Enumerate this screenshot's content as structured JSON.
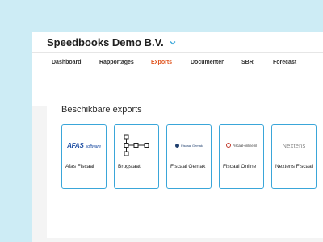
{
  "header": {
    "org_name": "Speedbooks Demo B.V."
  },
  "tabs": [
    {
      "label": "Dashboard",
      "active": false
    },
    {
      "label": "Rapportages",
      "active": false
    },
    {
      "label": "Exports",
      "active": true
    },
    {
      "label": "Documenten",
      "active": false
    },
    {
      "label": "SBR",
      "active": false
    },
    {
      "label": "Forecast",
      "active": false
    }
  ],
  "exports": {
    "title": "Beschikbare exports",
    "items": [
      {
        "label": "Afas Fiscaal",
        "logo_text": "AFAS",
        "logo_sub": "software",
        "icon": "afas-logo"
      },
      {
        "label": "Brugstaat",
        "icon": "tree-diagram-icon"
      },
      {
        "label": "Fiscaal Gemak",
        "logo_text": "Fiscaal Gemak",
        "icon": "fiscaal-gemak-logo"
      },
      {
        "label": "Fiscaal Online",
        "logo_text": "Fiscaal-online.nl",
        "icon": "fiscaal-online-logo"
      },
      {
        "label": "Nextens Fiscaal",
        "logo_text": "Nextens",
        "icon": "nextens-logo"
      }
    ]
  },
  "colors": {
    "background": "#cdecf5",
    "accent": "#e0551f",
    "tile_border": "#3aa6d9"
  }
}
